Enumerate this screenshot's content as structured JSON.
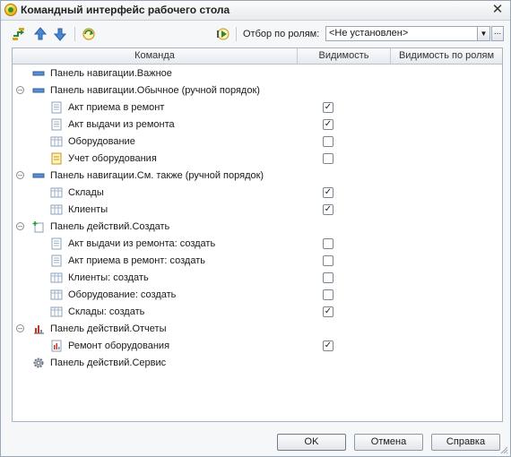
{
  "window": {
    "title": "Командный интерфейс рабочего стола",
    "close_glyph": "✕"
  },
  "toolbar": {
    "filter_label": "Отбор по ролям:",
    "filter_value": "<Не установлен>",
    "dropdown_glyph": "▼",
    "more_glyph": "..."
  },
  "grid": {
    "columns": [
      "Команда",
      "Видимость",
      "Видимость по ролям"
    ],
    "rows": [
      {
        "label": "Панель навигации.Важное",
        "level": 0,
        "expander": "",
        "icon": "nav-panel-icon",
        "checkbox": false
      },
      {
        "label": "Панель навигации.Обычное (ручной порядок)",
        "level": 0,
        "expander": "⊖",
        "icon": "nav-panel-icon",
        "checkbox": false
      },
      {
        "label": "Акт приема в ремонт",
        "level": 1,
        "expander": "",
        "icon": "document-icon",
        "checkbox": true,
        "checked": true
      },
      {
        "label": "Акт выдачи из ремонта",
        "level": 1,
        "expander": "",
        "icon": "document-icon",
        "checkbox": true,
        "checked": true
      },
      {
        "label": "Оборудование",
        "level": 1,
        "expander": "",
        "icon": "catalog-icon",
        "checkbox": true,
        "checked": false
      },
      {
        "label": "Учет оборудования",
        "level": 1,
        "expander": "",
        "icon": "register-icon",
        "checkbox": true,
        "checked": false
      },
      {
        "label": "Панель навигации.См. также (ручной порядок)",
        "level": 0,
        "expander": "⊖",
        "icon": "nav-panel-icon",
        "checkbox": false
      },
      {
        "label": "Склады",
        "level": 1,
        "expander": "",
        "icon": "catalog-icon",
        "checkbox": true,
        "checked": true
      },
      {
        "label": "Клиенты",
        "level": 1,
        "expander": "",
        "icon": "catalog-icon",
        "checkbox": true,
        "checked": true
      },
      {
        "label": "Панель действий.Создать",
        "level": 0,
        "expander": "⊖",
        "icon": "create-action-icon",
        "checkbox": false
      },
      {
        "label": "Акт выдачи из ремонта: создать",
        "level": 1,
        "expander": "",
        "icon": "document-icon",
        "checkbox": true,
        "checked": false
      },
      {
        "label": "Акт приема в ремонт: создать",
        "level": 1,
        "expander": "",
        "icon": "document-icon",
        "checkbox": true,
        "checked": false
      },
      {
        "label": "Клиенты: создать",
        "level": 1,
        "expander": "",
        "icon": "catalog-icon",
        "checkbox": true,
        "checked": false
      },
      {
        "label": "Оборудование: создать",
        "level": 1,
        "expander": "",
        "icon": "catalog-icon",
        "checkbox": true,
        "checked": false
      },
      {
        "label": "Склады: создать",
        "level": 1,
        "expander": "",
        "icon": "catalog-icon",
        "checkbox": true,
        "checked": true
      },
      {
        "label": "Панель действий.Отчеты",
        "level": 0,
        "expander": "⊖",
        "icon": "reports-icon",
        "checkbox": false
      },
      {
        "label": "Ремонт оборудования",
        "level": 1,
        "expander": "",
        "icon": "report-icon",
        "checkbox": true,
        "checked": true
      },
      {
        "label": "Панель действий.Сервис",
        "level": 0,
        "expander": "",
        "icon": "gear-icon",
        "checkbox": false
      }
    ]
  },
  "footer": {
    "ok_label": "OK",
    "cancel_label": "Отмена",
    "help_label": "Справка"
  }
}
